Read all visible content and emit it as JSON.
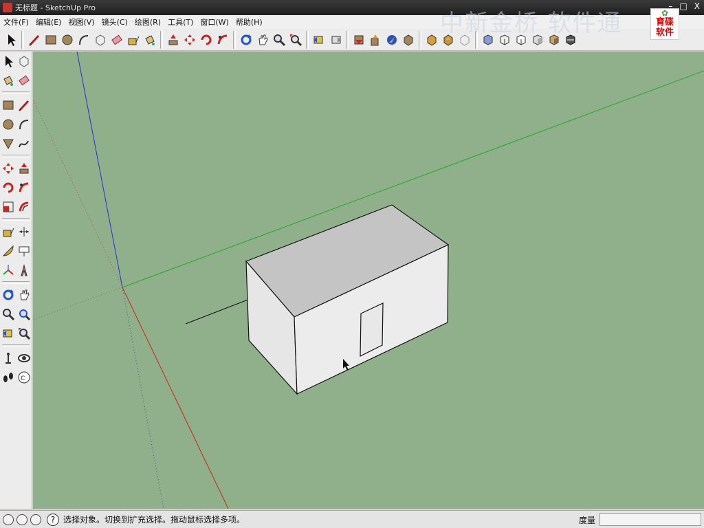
{
  "window": {
    "title": "无标题 - SketchUp Pro",
    "minimize": "–",
    "maximize": "□",
    "close": "X"
  },
  "watermark": {
    "text": "中新金桥  软件通"
  },
  "logo": {
    "line1": "育碟",
    "line2": "软件"
  },
  "menu": [
    {
      "label": "文件(F)"
    },
    {
      "label": "编辑(E)"
    },
    {
      "label": "视图(V)"
    },
    {
      "label": "镜头(C)"
    },
    {
      "label": "绘图(R)"
    },
    {
      "label": "工具(T)"
    },
    {
      "label": "窗口(W)"
    },
    {
      "label": "帮助(H)"
    }
  ],
  "toolbar_top": [
    "select-icon",
    "pencil-icon",
    "rectangle-icon",
    "circle-icon",
    "arc-icon",
    "make-component-icon",
    "eraser-icon",
    "tape-measure-icon",
    "paint-bucket-icon",
    "push-pull-icon",
    "move-icon",
    "rotate-icon",
    "follow-me-icon",
    "orbit-icon",
    "pan-icon",
    "zoom-icon",
    "zoom-extents-icon",
    "previous-view-icon",
    "next-view-icon",
    "get-models-icon",
    "share-model-icon",
    "share-component-icon",
    "extension-icon",
    "section-icon",
    "section-display-icon",
    "section-cut-icon",
    "xray-icon",
    "wireframe-icon",
    "hidden-line-icon",
    "shaded-icon",
    "textured-icon",
    "monochrome-icon"
  ],
  "toolbar_left": [
    [
      "select-icon",
      "make-component-icon"
    ],
    [
      "paint-bucket-icon",
      "eraser-icon"
    ],
    [
      "rectangle-icon",
      "line-icon"
    ],
    [
      "circle-icon",
      "arc-icon"
    ],
    [
      "polygon-icon",
      "freehand-icon"
    ],
    [
      "move-icon",
      "push-pull-icon"
    ],
    [
      "rotate-icon",
      "follow-me-icon"
    ],
    [
      "scale-icon",
      "offset-icon"
    ],
    [
      "tape-measure-icon",
      "dimension-icon"
    ],
    [
      "protractor-icon",
      "text-icon"
    ],
    [
      "axes-icon",
      "3d-text-icon"
    ],
    [
      "orbit-icon",
      "pan-icon"
    ],
    [
      "zoom-icon",
      "zoom-window-icon"
    ],
    [
      "previous-view-icon",
      "zoom-extents-icon"
    ],
    [
      "position-camera-icon",
      "look-around-icon"
    ],
    [
      "walk-icon",
      "section-plane-icon"
    ]
  ],
  "colors": {
    "viewport_bg": "#8fb08a",
    "axis_red": "#cc2222",
    "axis_green": "#22aa22",
    "axis_blue": "#2233cc",
    "face_top": "#c4c4c4",
    "face_front": "#ececec",
    "face_side": "#e4e4e4"
  },
  "status": {
    "text": "选择对象。切换到扩充选择。拖动鼠标选择多项。",
    "help": "?",
    "measure_label": "度量"
  }
}
